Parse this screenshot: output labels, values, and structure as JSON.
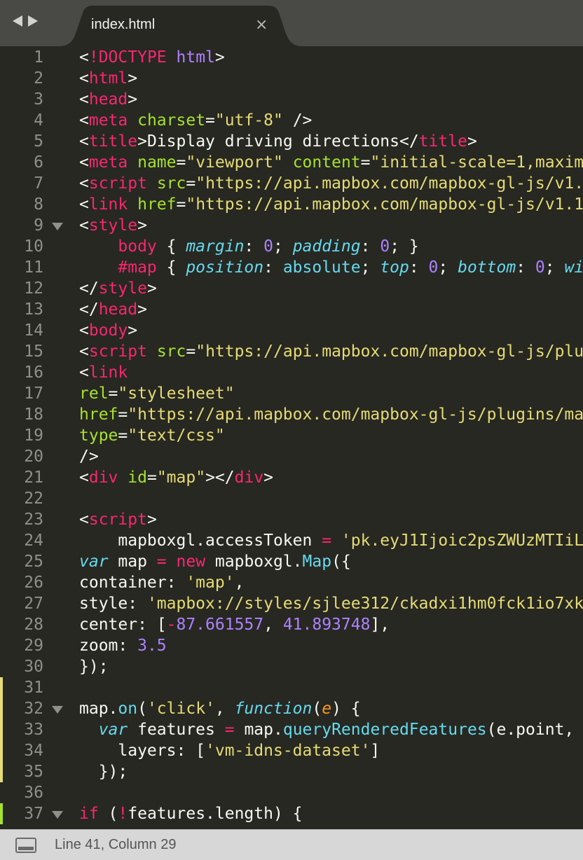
{
  "tab": {
    "title": "index.html",
    "close_glyph": "×"
  },
  "status": {
    "position": "Line 41, Column 29"
  },
  "colors": {
    "background": "#272822",
    "tag": "#f92672",
    "attr": "#a6e22e",
    "string": "#e6db74",
    "number": "#ae81ff",
    "type": "#66d9ef",
    "modified_marker": "#e6db74",
    "added_marker": "#a6e22e"
  },
  "lines": [
    {
      "n": "1",
      "tokens": [
        [
          "plain",
          "<"
        ],
        [
          "tag",
          "!DOCTYPE"
        ],
        [
          "plain",
          " "
        ],
        [
          "num",
          "html"
        ],
        [
          "plain",
          ">"
        ]
      ]
    },
    {
      "n": "2",
      "tokens": [
        [
          "plain",
          "<"
        ],
        [
          "tag",
          "html"
        ],
        [
          "plain",
          ">"
        ]
      ]
    },
    {
      "n": "3",
      "tokens": [
        [
          "plain",
          "<"
        ],
        [
          "tag",
          "head"
        ],
        [
          "plain",
          ">"
        ]
      ]
    },
    {
      "n": "4",
      "tokens": [
        [
          "plain",
          "<"
        ],
        [
          "tag",
          "meta"
        ],
        [
          "plain",
          " "
        ],
        [
          "attr",
          "charset"
        ],
        [
          "plain",
          "="
        ],
        [
          "str",
          "\"utf-8\""
        ],
        [
          "plain",
          " />"
        ]
      ]
    },
    {
      "n": "5",
      "tokens": [
        [
          "plain",
          "<"
        ],
        [
          "tag",
          "title"
        ],
        [
          "plain",
          ">Display driving directions</"
        ],
        [
          "tag",
          "title"
        ],
        [
          "plain",
          ">"
        ]
      ]
    },
    {
      "n": "6",
      "tokens": [
        [
          "plain",
          "<"
        ],
        [
          "tag",
          "meta"
        ],
        [
          "plain",
          " "
        ],
        [
          "attr",
          "name"
        ],
        [
          "plain",
          "="
        ],
        [
          "str",
          "\"viewport\""
        ],
        [
          "plain",
          " "
        ],
        [
          "attr",
          "content"
        ],
        [
          "plain",
          "="
        ],
        [
          "str",
          "\"initial-scale=1,maxim"
        ]
      ]
    },
    {
      "n": "7",
      "tokens": [
        [
          "plain",
          "<"
        ],
        [
          "tag",
          "script"
        ],
        [
          "plain",
          " "
        ],
        [
          "attr",
          "src"
        ],
        [
          "plain",
          "="
        ],
        [
          "str",
          "\"https://api.mapbox.com/mapbox-gl-js/v1."
        ]
      ]
    },
    {
      "n": "8",
      "tokens": [
        [
          "plain",
          "<"
        ],
        [
          "tag",
          "link"
        ],
        [
          "plain",
          " "
        ],
        [
          "attr",
          "href"
        ],
        [
          "plain",
          "="
        ],
        [
          "str",
          "\"https://api.mapbox.com/mapbox-gl-js/v1.1"
        ]
      ]
    },
    {
      "n": "9",
      "fold": true,
      "tokens": [
        [
          "plain",
          "<"
        ],
        [
          "tag",
          "style"
        ],
        [
          "plain",
          ">"
        ]
      ]
    },
    {
      "n": "10",
      "tokens": [
        [
          "plain",
          "    "
        ],
        [
          "tag",
          "body"
        ],
        [
          "plain",
          " { "
        ],
        [
          "prop",
          "margin"
        ],
        [
          "plain",
          ": "
        ],
        [
          "num",
          "0"
        ],
        [
          "plain",
          "; "
        ],
        [
          "prop",
          "padding"
        ],
        [
          "plain",
          ": "
        ],
        [
          "num",
          "0"
        ],
        [
          "plain",
          "; }"
        ]
      ]
    },
    {
      "n": "11",
      "tokens": [
        [
          "plain",
          "    "
        ],
        [
          "tag",
          "#map"
        ],
        [
          "plain",
          " { "
        ],
        [
          "prop",
          "position"
        ],
        [
          "plain",
          ": "
        ],
        [
          "val",
          "absolute"
        ],
        [
          "plain",
          "; "
        ],
        [
          "prop",
          "top"
        ],
        [
          "plain",
          ": "
        ],
        [
          "num",
          "0"
        ],
        [
          "plain",
          "; "
        ],
        [
          "prop",
          "bottom"
        ],
        [
          "plain",
          ": "
        ],
        [
          "num",
          "0"
        ],
        [
          "plain",
          "; "
        ],
        [
          "prop",
          "wi"
        ]
      ]
    },
    {
      "n": "12",
      "tokens": [
        [
          "plain",
          "</"
        ],
        [
          "tag",
          "style"
        ],
        [
          "plain",
          ">"
        ]
      ]
    },
    {
      "n": "13",
      "tokens": [
        [
          "plain",
          "</"
        ],
        [
          "tag",
          "head"
        ],
        [
          "plain",
          ">"
        ]
      ]
    },
    {
      "n": "14",
      "tokens": [
        [
          "plain",
          "<"
        ],
        [
          "tag",
          "body"
        ],
        [
          "plain",
          ">"
        ]
      ]
    },
    {
      "n": "15",
      "tokens": [
        [
          "plain",
          "<"
        ],
        [
          "tag",
          "script"
        ],
        [
          "plain",
          " "
        ],
        [
          "attr",
          "src"
        ],
        [
          "plain",
          "="
        ],
        [
          "str",
          "\"https://api.mapbox.com/mapbox-gl-js/plu"
        ]
      ]
    },
    {
      "n": "16",
      "tokens": [
        [
          "plain",
          "<"
        ],
        [
          "tag",
          "link"
        ]
      ]
    },
    {
      "n": "17",
      "tokens": [
        [
          "attr",
          "rel"
        ],
        [
          "plain",
          "="
        ],
        [
          "str",
          "\"stylesheet\""
        ]
      ]
    },
    {
      "n": "18",
      "tokens": [
        [
          "attr",
          "href"
        ],
        [
          "plain",
          "="
        ],
        [
          "str",
          "\"https://api.mapbox.com/mapbox-gl-js/plugins/ma"
        ]
      ]
    },
    {
      "n": "19",
      "tokens": [
        [
          "attr",
          "type"
        ],
        [
          "plain",
          "="
        ],
        [
          "str",
          "\"text/css\""
        ]
      ]
    },
    {
      "n": "20",
      "tokens": [
        [
          "plain",
          "/>"
        ]
      ]
    },
    {
      "n": "21",
      "tokens": [
        [
          "plain",
          "<"
        ],
        [
          "tag",
          "div"
        ],
        [
          "plain",
          " "
        ],
        [
          "attr",
          "id"
        ],
        [
          "plain",
          "="
        ],
        [
          "str",
          "\"map\""
        ],
        [
          "plain",
          "></"
        ],
        [
          "tag",
          "div"
        ],
        [
          "plain",
          ">"
        ]
      ]
    },
    {
      "n": "22",
      "tokens": []
    },
    {
      "n": "23",
      "tokens": [
        [
          "plain",
          "<"
        ],
        [
          "tag",
          "script"
        ],
        [
          "plain",
          ">"
        ]
      ]
    },
    {
      "n": "24",
      "tokens": [
        [
          "plain",
          "    mapboxgl.accessToken "
        ],
        [
          "kw",
          "="
        ],
        [
          "plain",
          " "
        ],
        [
          "str",
          "'pk.eyJ1Ijoic2psZWUzMTIiL"
        ]
      ]
    },
    {
      "n": "25",
      "tokens": [
        [
          "type",
          "var"
        ],
        [
          "plain",
          " map "
        ],
        [
          "kw",
          "="
        ],
        [
          "plain",
          " "
        ],
        [
          "kw",
          "new"
        ],
        [
          "plain",
          " mapboxgl."
        ],
        [
          "fn",
          "Map"
        ],
        [
          "plain",
          "({"
        ]
      ]
    },
    {
      "n": "26",
      "tokens": [
        [
          "plain",
          "container: "
        ],
        [
          "str",
          "'map'"
        ],
        [
          "plain",
          ","
        ]
      ]
    },
    {
      "n": "27",
      "tokens": [
        [
          "plain",
          "style: "
        ],
        [
          "str",
          "'mapbox://styles/sjlee312/ckadxi1hm0fck1io7xk"
        ]
      ]
    },
    {
      "n": "28",
      "tokens": [
        [
          "plain",
          "center: ["
        ],
        [
          "kw",
          "-"
        ],
        [
          "num",
          "87.661557"
        ],
        [
          "plain",
          ", "
        ],
        [
          "num",
          "41.893748"
        ],
        [
          "plain",
          "],"
        ]
      ]
    },
    {
      "n": "29",
      "tokens": [
        [
          "plain",
          "zoom: "
        ],
        [
          "num",
          "3.5"
        ]
      ]
    },
    {
      "n": "30",
      "tokens": [
        [
          "plain",
          "});"
        ]
      ]
    },
    {
      "n": "31",
      "mod": "modified",
      "tokens": []
    },
    {
      "n": "32",
      "mod": "modified",
      "fold": true,
      "tokens": [
        [
          "plain",
          "map."
        ],
        [
          "fn",
          "on"
        ],
        [
          "plain",
          "("
        ],
        [
          "str",
          "'click'"
        ],
        [
          "plain",
          ", "
        ],
        [
          "type",
          "function"
        ],
        [
          "plain",
          "("
        ],
        [
          "param",
          "e"
        ],
        [
          "plain",
          ") "
        ],
        [
          "plain",
          "{"
        ]
      ]
    },
    {
      "n": "33",
      "mod": "modified",
      "tokens": [
        [
          "plain",
          "  "
        ],
        [
          "type",
          "var"
        ],
        [
          "plain",
          " features "
        ],
        [
          "kw",
          "="
        ],
        [
          "plain",
          " map."
        ],
        [
          "fn",
          "queryRenderedFeatures"
        ],
        [
          "plain",
          "(e.point,"
        ]
      ]
    },
    {
      "n": "34",
      "mod": "modified",
      "tokens": [
        [
          "plain",
          "    layers: ["
        ],
        [
          "str",
          "'vm-idns-dataset'"
        ],
        [
          "plain",
          "]"
        ]
      ]
    },
    {
      "n": "35",
      "mod": "modified",
      "tokens": [
        [
          "plain",
          "  });"
        ]
      ]
    },
    {
      "n": "36",
      "tokens": []
    },
    {
      "n": "37",
      "mod": "added",
      "fold": true,
      "tokens": [
        [
          "kw",
          "if"
        ],
        [
          "plain",
          " ("
        ],
        [
          "kw",
          "!"
        ],
        [
          "plain",
          "features.length) {"
        ]
      ]
    }
  ]
}
